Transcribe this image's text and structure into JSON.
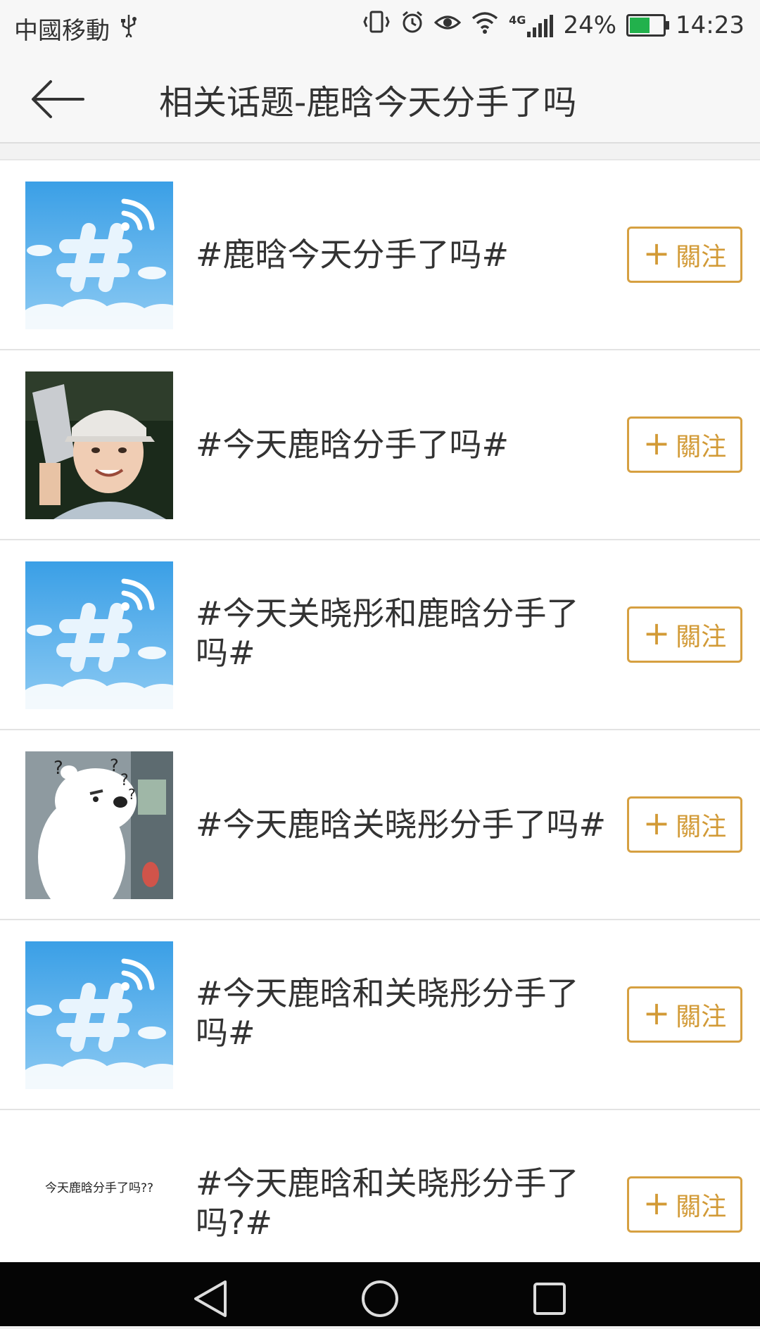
{
  "status_bar": {
    "carrier": "中國移動",
    "usb_icon": "usb-icon",
    "network": "4G",
    "battery": "24%",
    "battery_level": 0.24,
    "time": "14:23"
  },
  "header": {
    "title": "相关话题-鹿晗今天分手了吗",
    "back_icon": "arrow-left-icon"
  },
  "topics": [
    {
      "title_line1": "#鹿晗今天分手了吗#",
      "title_line2": "",
      "thumb": "hashtag-cloud",
      "follow_label": "關注"
    },
    {
      "title_line1": "#今天鹿晗分手了吗#",
      "title_line2": "",
      "thumb": "person-photo",
      "follow_label": "關注"
    },
    {
      "title_line1": "#今天关晓彤和鹿晗分手了",
      "title_line2": "吗#",
      "thumb": "hashtag-cloud",
      "follow_label": "關注"
    },
    {
      "title_line1": "#今天鹿晗关晓彤分手了吗#",
      "title_line2": "",
      "thumb": "bear-cartoon",
      "follow_label": "關注"
    },
    {
      "title_line1": "#今天鹿晗和关晓彤分手了",
      "title_line2": "吗#",
      "thumb": "hashtag-cloud",
      "follow_label": "關注"
    },
    {
      "title_line1": "#今天鹿晗和关晓彤分手了",
      "title_line2": "吗?#",
      "thumb": "text",
      "thumb_text": "今天鹿晗分手了吗??",
      "follow_label": "關注"
    }
  ],
  "nav": {
    "back": "triangle-back-icon",
    "home": "circle-home-icon",
    "recents": "square-recents-icon"
  }
}
